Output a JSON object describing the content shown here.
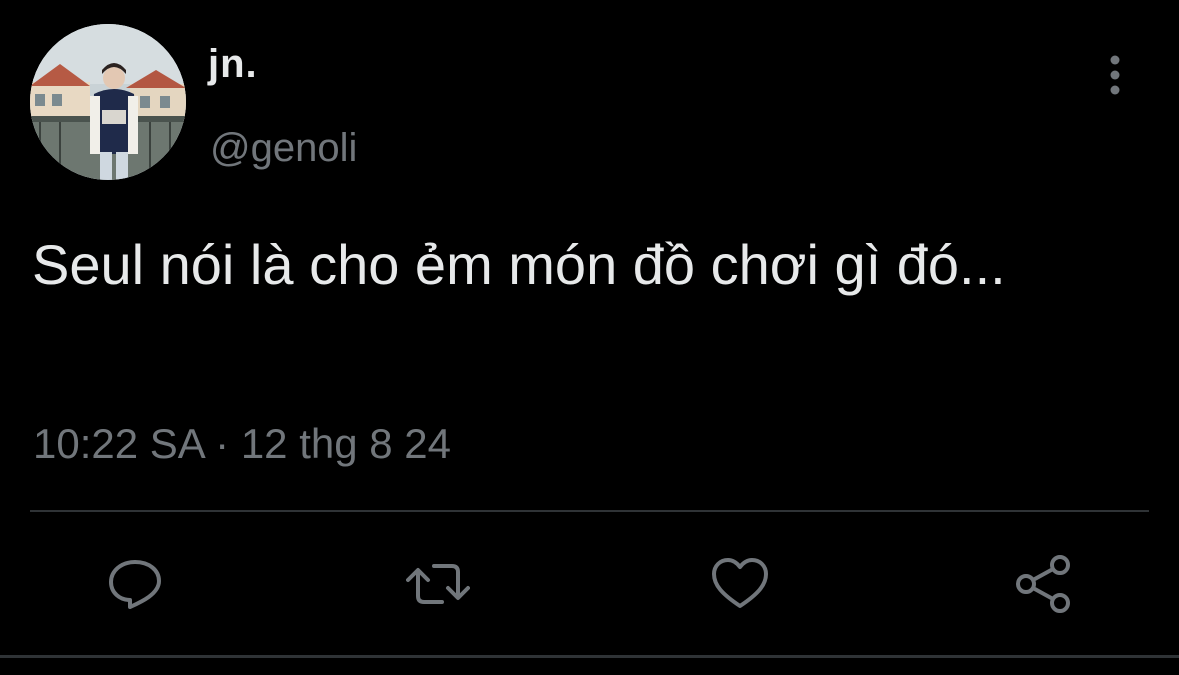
{
  "tweet": {
    "author": {
      "display_name": "jn.",
      "handle": "@genoli"
    },
    "text": "Seul nói là cho ẻm món đồ chơi gì đó...",
    "time": "10:22 SA",
    "separator": " · ",
    "date": "12 thg 8 24"
  },
  "icons": {
    "more": "vertical-dots-icon",
    "reply": "reply-icon",
    "retweet": "retweet-icon",
    "like": "heart-icon",
    "share": "share-icon"
  },
  "colors": {
    "background": "#000000",
    "primary_text": "#e7e9ea",
    "secondary_text": "#71767b",
    "divider": "#2f3336"
  }
}
